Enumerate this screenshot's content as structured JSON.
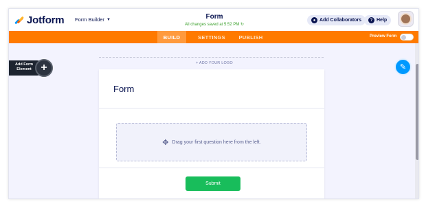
{
  "header": {
    "brand": "Jotform",
    "builder_dropdown": "Form Builder",
    "form_title": "Form",
    "save_status": "All changes saved at 5:52 PM",
    "add_collaborators": "Add Collaborators",
    "help": "Help"
  },
  "nav": {
    "tabs": [
      {
        "label": "BUILD",
        "active": true
      },
      {
        "label": "SETTINGS",
        "active": false
      },
      {
        "label": "PUBLISH",
        "active": false
      }
    ],
    "preview_label": "Preview Form",
    "preview_enabled": false
  },
  "sidebar": {
    "add_element_label": "Add Form Element"
  },
  "canvas": {
    "add_logo": "+ ADD YOUR LOGO",
    "form_heading": "Form",
    "dropzone_text": "Drag your first question here from the left.",
    "submit_label": "Submit"
  },
  "colors": {
    "brand_orange": "#ff7a00",
    "submit_green": "#18bd5b",
    "accent_blue": "#0099ff",
    "navy": "#0a1551"
  },
  "icons": [
    "jotform-logo-icon",
    "chevron-down-icon",
    "user-icon",
    "help-icon",
    "plus-icon",
    "move-icon",
    "paint-brush-icon",
    "sync-icon"
  ]
}
